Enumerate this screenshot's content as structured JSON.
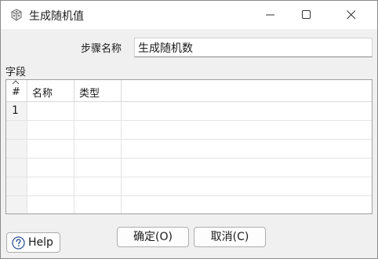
{
  "window": {
    "title": "生成随机值"
  },
  "form": {
    "step_name_label": "步骤名称",
    "step_name_value": "生成随机数",
    "fields_label": "字段"
  },
  "grid": {
    "columns": [
      "#",
      "名称",
      "类型",
      ""
    ],
    "rows": [
      {
        "num": "1",
        "name": "",
        "type": ""
      },
      {
        "num": "",
        "name": "",
        "type": ""
      },
      {
        "num": "",
        "name": "",
        "type": ""
      },
      {
        "num": "",
        "name": "",
        "type": ""
      },
      {
        "num": "",
        "name": "",
        "type": ""
      },
      {
        "num": "",
        "name": "",
        "type": ""
      }
    ]
  },
  "buttons": {
    "ok": "确定(O)",
    "cancel": "取消(C)",
    "help": "Help"
  },
  "icons": {
    "app": "random-dice-icon",
    "minimize": "minimize-icon",
    "maximize": "maximize-icon",
    "close": "close-icon",
    "help": "help-icon",
    "sort": "sort-indicator-icon"
  },
  "colors": {
    "background": "#f0f0f0",
    "titlebar": "#ffffff",
    "grid_border": "#a0a0a0"
  }
}
